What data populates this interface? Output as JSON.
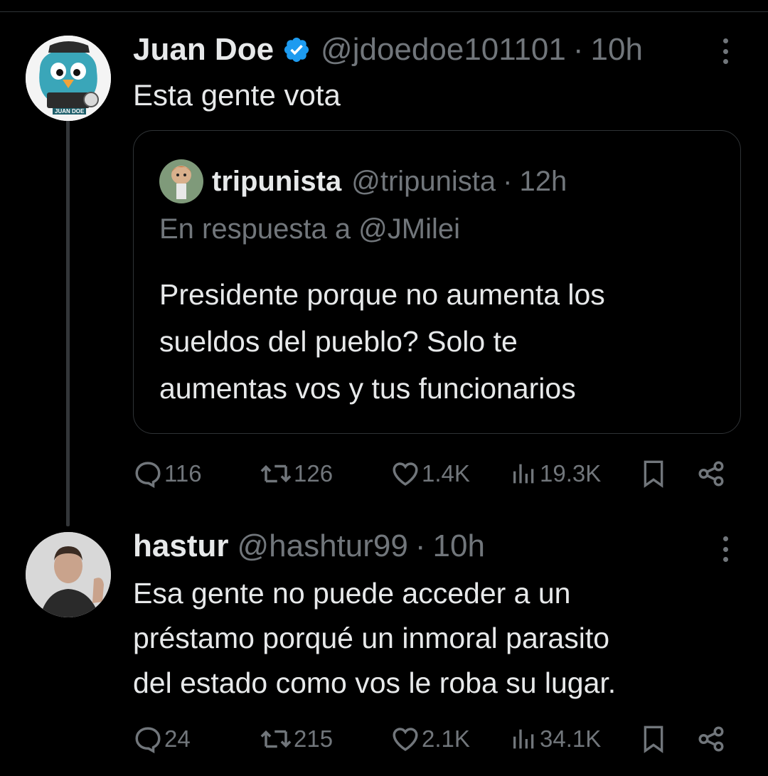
{
  "colors": {
    "background": "#000000",
    "text": "#e7e9ea",
    "muted": "#71767b",
    "border": "#2f3336",
    "verified": "#1d9bf0"
  },
  "main_tweet": {
    "author_name": "Juan Doe",
    "verified": true,
    "handle": "@jdoedoe101101",
    "separator": "·",
    "time": "10h",
    "text": "Esta gente vota",
    "avatar_badge": "JUAN DOE",
    "quote": {
      "author_name": "tripunista",
      "handle": "@tripunista",
      "separator": "·",
      "time": "12h",
      "reply_to": "En respuesta a @JMilei",
      "text": "Presidente porque no aumenta los\nsueldos del pueblo? Solo te\naumentas vos y tus funcionarios"
    },
    "actions": {
      "replies": "116",
      "reposts": "126",
      "likes": "1.4K",
      "views": "19.3K"
    }
  },
  "reply_tweet": {
    "author_name": "hastur",
    "handle": "@hashtur99",
    "separator": "·",
    "time": "10h",
    "text": "Esa gente no puede acceder a un\npréstamo porqué un inmoral parasito\ndel estado como vos le roba su lugar.",
    "actions": {
      "replies": "24",
      "reposts": "215",
      "likes": "2.1K",
      "views": "34.1K"
    }
  },
  "icons": [
    "verified-badge-icon",
    "more-icon",
    "reply-icon",
    "repost-icon",
    "like-icon",
    "views-icon",
    "bookmark-icon",
    "share-icon"
  ]
}
